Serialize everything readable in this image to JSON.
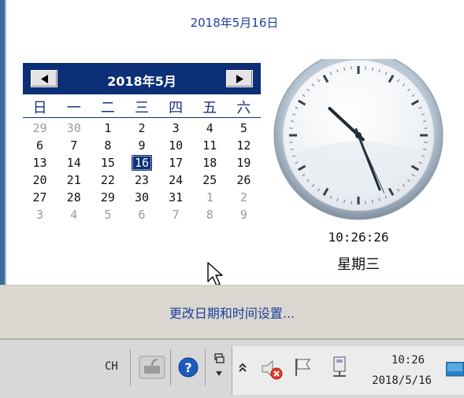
{
  "header": {
    "date_long": "2018年5月16日"
  },
  "calendar": {
    "month_title": "2018年5月",
    "weekdays": [
      "日",
      "一",
      "二",
      "三",
      "四",
      "五",
      "六"
    ],
    "weeks": [
      [
        {
          "d": "29",
          "o": true
        },
        {
          "d": "30",
          "o": true
        },
        {
          "d": "1"
        },
        {
          "d": "2"
        },
        {
          "d": "3"
        },
        {
          "d": "4"
        },
        {
          "d": "5"
        }
      ],
      [
        {
          "d": "6"
        },
        {
          "d": "7"
        },
        {
          "d": "8"
        },
        {
          "d": "9"
        },
        {
          "d": "10"
        },
        {
          "d": "11"
        },
        {
          "d": "12"
        }
      ],
      [
        {
          "d": "13"
        },
        {
          "d": "14"
        },
        {
          "d": "15"
        },
        {
          "d": "16",
          "s": true
        },
        {
          "d": "17"
        },
        {
          "d": "18"
        },
        {
          "d": "19"
        }
      ],
      [
        {
          "d": "20"
        },
        {
          "d": "21"
        },
        {
          "d": "22"
        },
        {
          "d": "23"
        },
        {
          "d": "24"
        },
        {
          "d": "25"
        },
        {
          "d": "26"
        }
      ],
      [
        {
          "d": "27"
        },
        {
          "d": "28"
        },
        {
          "d": "29"
        },
        {
          "d": "30"
        },
        {
          "d": "31"
        },
        {
          "d": "1",
          "o": true
        },
        {
          "d": "2",
          "o": true
        }
      ],
      [
        {
          "d": "3",
          "o": true
        },
        {
          "d": "4",
          "o": true
        },
        {
          "d": "5",
          "o": true
        },
        {
          "d": "6",
          "o": true
        },
        {
          "d": "7",
          "o": true
        },
        {
          "d": "8",
          "o": true
        },
        {
          "d": "9",
          "o": true
        }
      ]
    ]
  },
  "clock": {
    "time": "10:26:26",
    "weekday": "星期三"
  },
  "settings": {
    "link_label": "更改日期和时间设置..."
  },
  "taskbar": {
    "language": "CH",
    "tray_time": "10:26",
    "tray_date": "2018/5/16",
    "icons": [
      "keyboard-icon",
      "help-icon",
      "window-icon",
      "chevron-up-icon",
      "volume-muted-icon",
      "flag-icon",
      "network-icon",
      "show-desktop-icon"
    ]
  },
  "colors": {
    "accent": "#0d2f78",
    "link": "#1f3f9c",
    "taskbar": "#d8d8d8"
  }
}
